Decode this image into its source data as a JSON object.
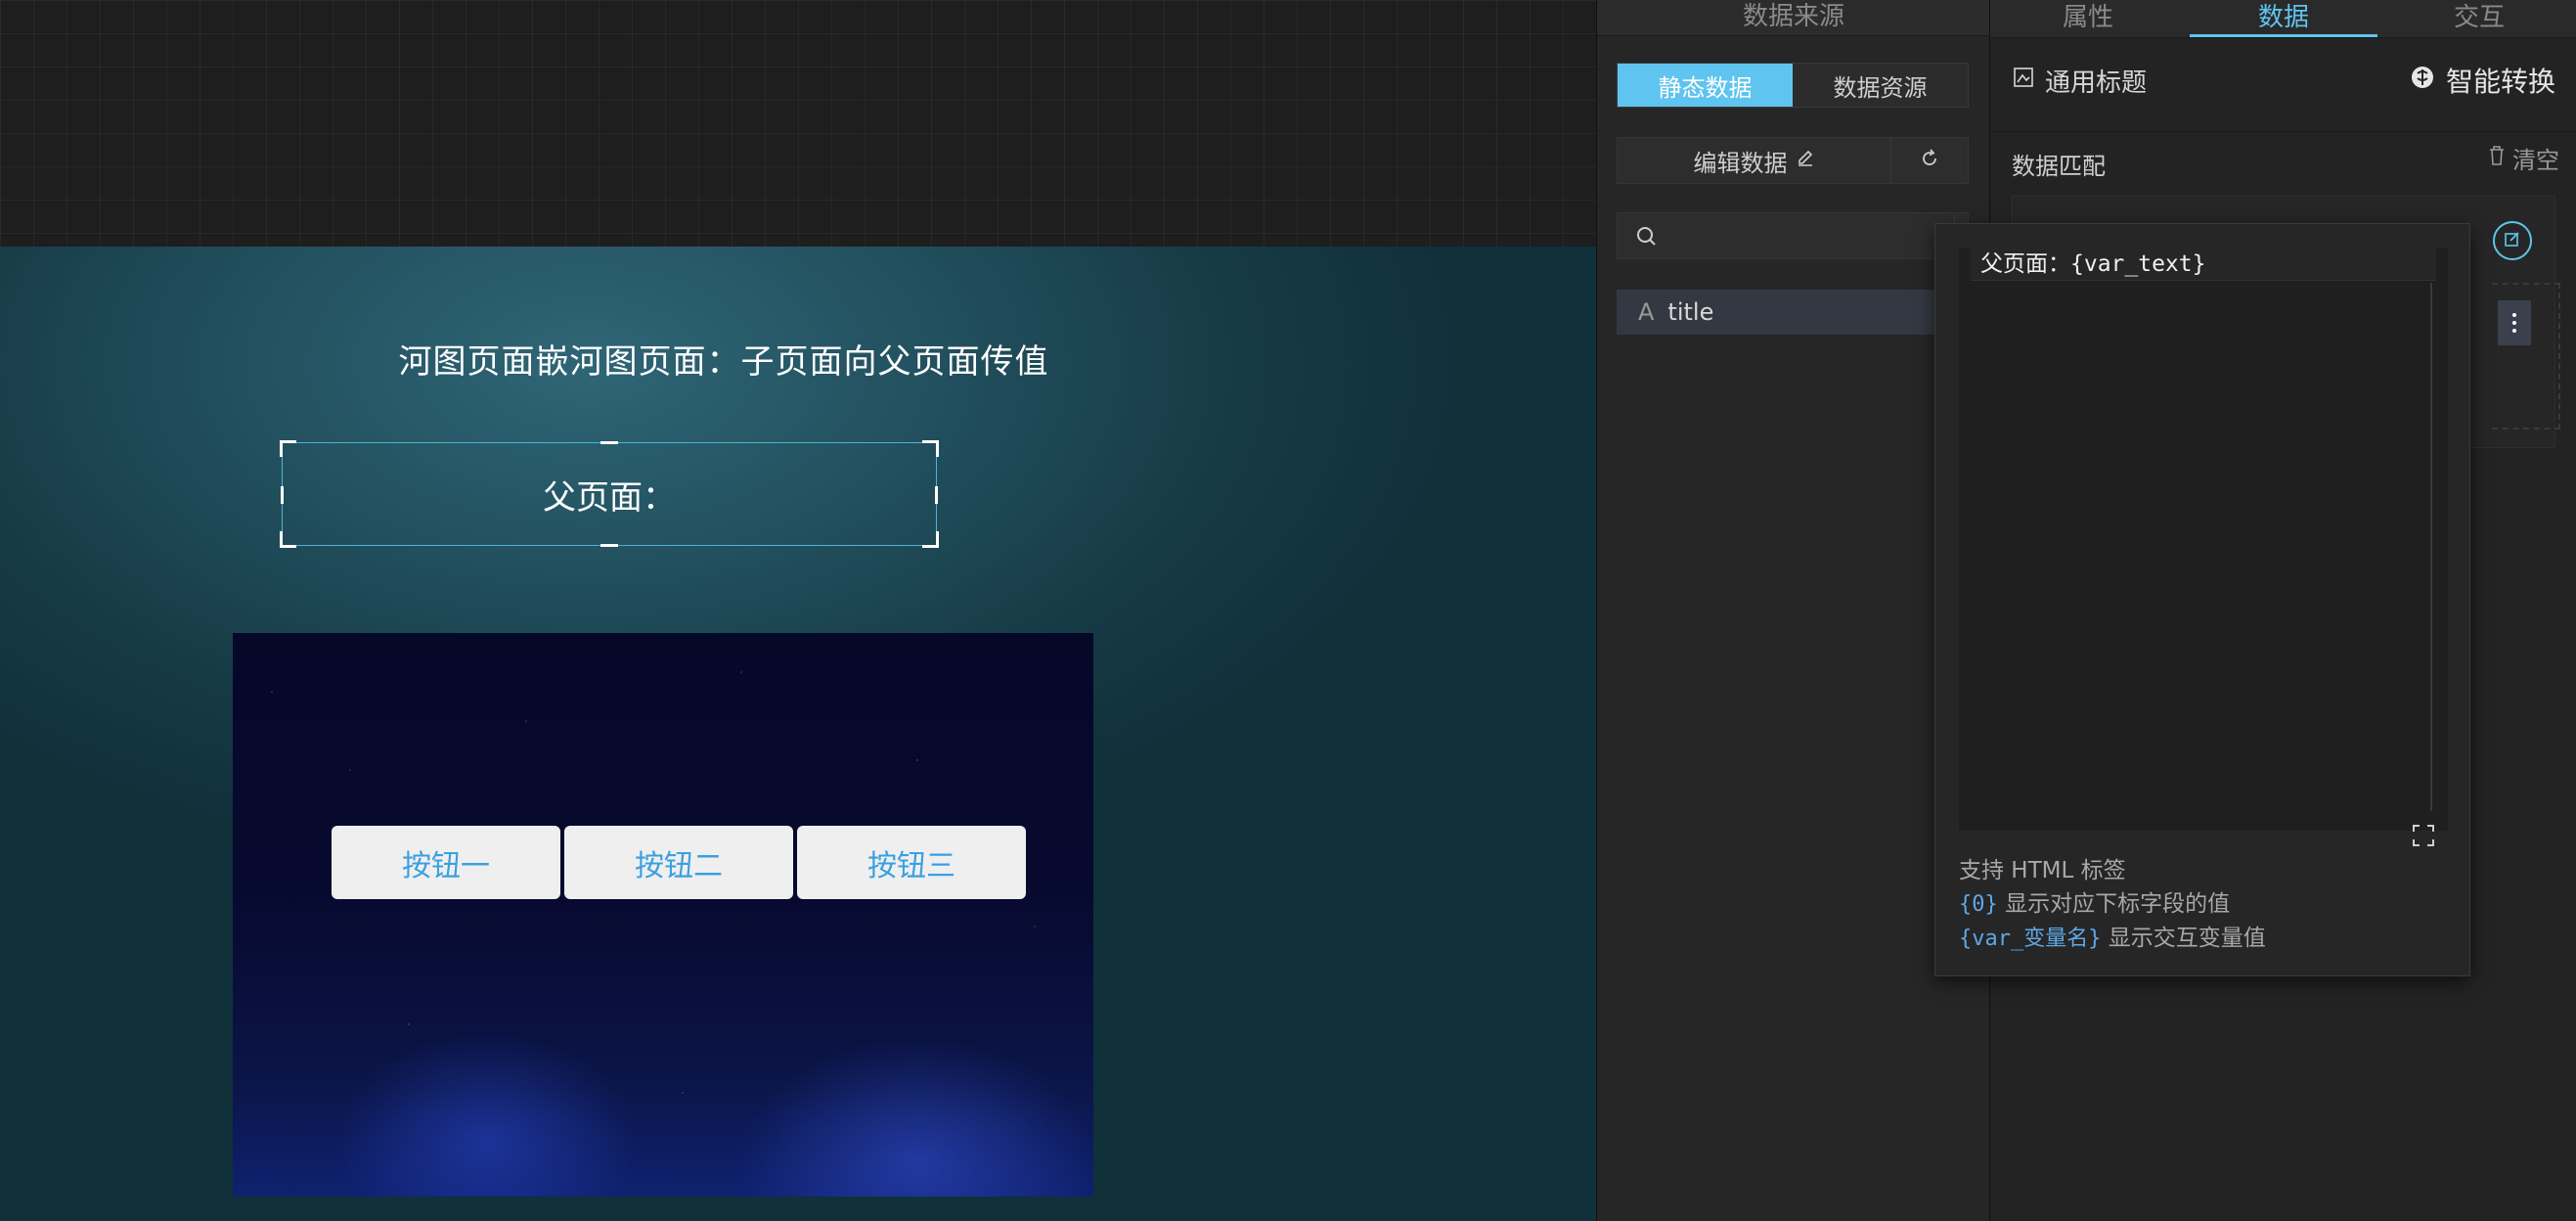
{
  "canvas": {
    "screen_title": "河图页面嵌河图页面：子页面向父页面传值",
    "parent_text": "父页面：",
    "child_buttons": [
      "按钮一",
      "按钮二",
      "按钮三"
    ]
  },
  "data_source_panel": {
    "header": "数据来源",
    "tabs": [
      "静态数据",
      "数据资源"
    ],
    "edit_label": "编辑数据",
    "search_placeholder": "",
    "field": {
      "type_icon": "A",
      "name": "title"
    }
  },
  "right_panel": {
    "tabs": [
      "属性",
      "数据",
      "交互"
    ],
    "active_tab": "数据",
    "component_name": "通用标题",
    "smart_convert": "智能转换",
    "data_match_label": "数据匹配",
    "clear_label": "清空"
  },
  "popover": {
    "code": "父页面：{var_text}",
    "help_line1": "支持 HTML 标签",
    "help_code2": "{0}",
    "help_text2": "显示对应下标字段的值",
    "help_code3": "{var_变量名}",
    "help_text3": "显示交互变量值"
  },
  "colors": {
    "accent": "#5fc4ef",
    "canvas_bg": "#1e1e1e",
    "panel_bg": "#262626",
    "button_text": "#3aa0e0"
  }
}
